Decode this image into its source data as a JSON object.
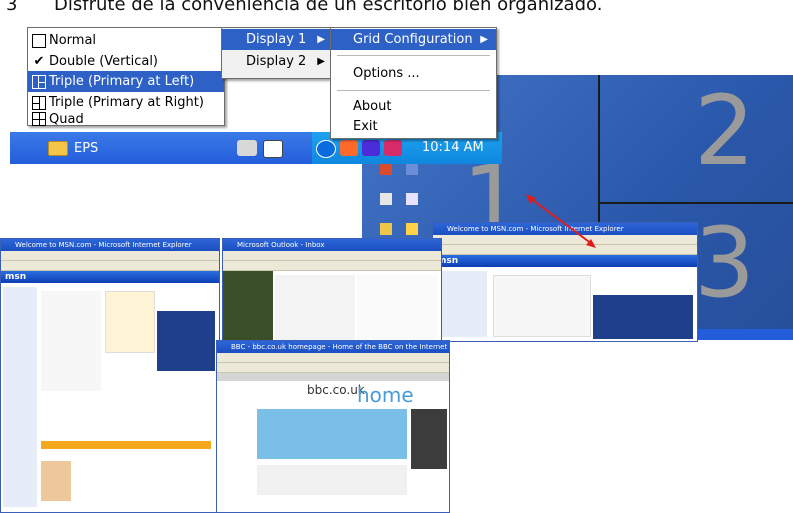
{
  "caption": {
    "number": "3",
    "text": "Disfrute de la conveniencia de un escritorio bien organizado."
  },
  "menus": {
    "layouts": [
      {
        "label": "Normal",
        "icon": "single-grid-icon",
        "checked": false,
        "selected": false
      },
      {
        "label": "Double (Vertical)",
        "icon": "checkmark-icon",
        "checked": true,
        "selected": false
      },
      {
        "label": "Triple (Primary at Left)",
        "icon": "triple-left-grid-icon",
        "checked": false,
        "selected": true
      },
      {
        "label": "Triple (Primary at Right)",
        "icon": "triple-right-grid-icon",
        "checked": false,
        "selected": false
      },
      {
        "label": "Quad",
        "icon": "quad-grid-icon",
        "checked": false,
        "selected": false
      }
    ],
    "displays": [
      {
        "label": "Display 1",
        "selected": true
      },
      {
        "label": "Display 2",
        "selected": false
      }
    ],
    "main": {
      "grid_configuration": "Grid Configuration",
      "options": "Options ...",
      "about": "About",
      "exit": "Exit"
    }
  },
  "taskbar": {
    "button": "EPS",
    "clock": "10:14 AM"
  },
  "desktop": {
    "grid_numbers": [
      "1",
      "2",
      "3"
    ]
  },
  "windows": {
    "msn_left": {
      "title": "Welcome to MSN.com - Microsoft Internet Explorer",
      "brand": "msn"
    },
    "outlook": {
      "title": "Microsoft Outlook - Inbox"
    },
    "bbc": {
      "title": "BBC - bbc.co.uk homepage - Home of the BBC on the Internet - Mozilla Firefox",
      "brand": "bbc.co.uk",
      "headline": "home"
    },
    "msn_right": {
      "title": "Welcome to MSN.com - Microsoft Internet Explorer",
      "brand": "msn"
    }
  },
  "colors": {
    "selection": "#2d61c6",
    "taskbar": "#245ddb",
    "desktop": "#2b5cb0",
    "grid_number": "#9a9a9a",
    "arrow": "#e21b1b"
  }
}
